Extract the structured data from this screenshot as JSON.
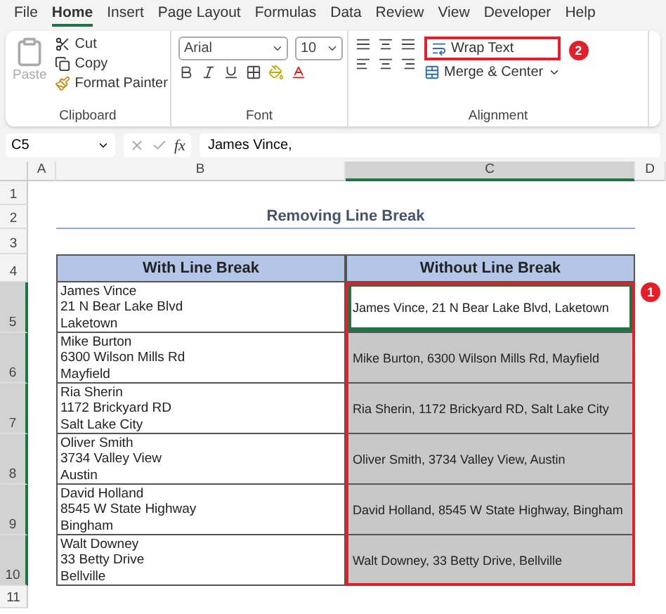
{
  "menu_tabs": [
    {
      "label": "File",
      "selected": false
    },
    {
      "label": "Home",
      "selected": true
    },
    {
      "label": "Insert",
      "selected": false
    },
    {
      "label": "Page Layout",
      "selected": false
    },
    {
      "label": "Formulas",
      "selected": false
    },
    {
      "label": "Data",
      "selected": false
    },
    {
      "label": "Review",
      "selected": false
    },
    {
      "label": "View",
      "selected": false
    },
    {
      "label": "Developer",
      "selected": false
    },
    {
      "label": "Help",
      "selected": false
    }
  ],
  "ribbon": {
    "clipboard": {
      "paste": "Paste",
      "cut": "Cut",
      "copy": "Copy",
      "format_painter": "Format Painter",
      "label": "Clipboard"
    },
    "font": {
      "font_name": "Arial",
      "font_size": "10",
      "label": "Font"
    },
    "alignment": {
      "wrap_text": "Wrap Text",
      "wrap_text_callout": "2",
      "merge_center": "Merge & Center",
      "label": "Alignment"
    }
  },
  "formula_bar": {
    "name_box": "C5",
    "fx_label": "fx",
    "formula": "James Vince,"
  },
  "columns": [
    {
      "label": "A",
      "selected": false
    },
    {
      "label": "B",
      "selected": false
    },
    {
      "label": "C",
      "selected": true
    },
    {
      "label": "D",
      "selected": false
    }
  ],
  "row_headers": [
    {
      "label": "1",
      "selected": false
    },
    {
      "label": "2",
      "selected": false
    },
    {
      "label": "3",
      "selected": false
    },
    {
      "label": "4",
      "selected": false
    },
    {
      "label": "5",
      "selected": true
    },
    {
      "label": "6",
      "selected": true
    },
    {
      "label": "7",
      "selected": true
    },
    {
      "label": "8",
      "selected": true
    },
    {
      "label": "9",
      "selected": true
    },
    {
      "label": "10",
      "selected": true
    },
    {
      "label": "11",
      "selected": false
    }
  ],
  "sheet_title": "Removing Line Break",
  "table": {
    "headers": [
      "With Line Break",
      "Without Line Break"
    ],
    "rows": [
      {
        "with_break": [
          "James Vince",
          "21 N Bear Lake Blvd",
          "Laketown"
        ],
        "without_break": "James Vince, 21 N Bear Lake Blvd, Laketown",
        "selected": true,
        "active": true
      },
      {
        "with_break": [
          "Mike Burton",
          "6300 Wilson Mills Rd",
          "Mayfield"
        ],
        "without_break": "Mike Burton, 6300 Wilson Mills Rd, Mayfield",
        "selected": true,
        "active": false
      },
      {
        "with_break": [
          "Ria Sherin",
          "1172 Brickyard RD",
          "Salt Lake City"
        ],
        "without_break": "Ria Sherin, 1172 Brickyard RD, Salt Lake City",
        "selected": true,
        "active": false
      },
      {
        "with_break": [
          "Oliver Smith",
          "3734 Valley View",
          "Austin"
        ],
        "without_break": "Oliver Smith, 3734 Valley View, Austin",
        "selected": true,
        "active": false
      },
      {
        "with_break": [
          "David Holland",
          "8545 W State Highway",
          "Bingham"
        ],
        "without_break": "David Holland, 8545 W State Highway, Bingham",
        "selected": true,
        "active": false
      },
      {
        "with_break": [
          "Walt Downey",
          "33 Betty Drive",
          "Bellville"
        ],
        "without_break": "Walt Downey, 33 Betty Drive, Bellville",
        "selected": true,
        "active": false
      }
    ],
    "callout": "1"
  }
}
